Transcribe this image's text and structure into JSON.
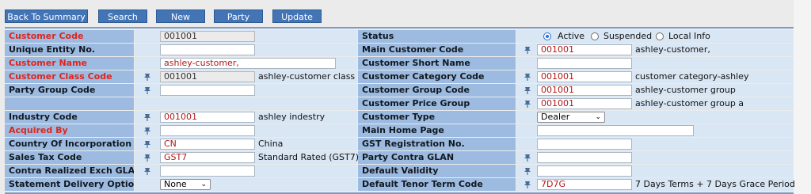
{
  "toolbar": {
    "back_label": "Back To Summary",
    "search_label": "Search",
    "new_label": "New",
    "party_label": "Party",
    "update_label": "Update"
  },
  "form": {
    "customer_code": {
      "label": "Customer Code",
      "value": "001001"
    },
    "unique_entity_no": {
      "label": "Unique Entity No.",
      "value": ""
    },
    "customer_name": {
      "label": "Customer Name",
      "value": "ashley-customer,"
    },
    "customer_class_code": {
      "label": "Customer Class Code",
      "value": "001001",
      "desc": "ashley-customer class"
    },
    "party_group_code": {
      "label": "Party Group Code",
      "value": ""
    },
    "industry_code": {
      "label": "Industry Code",
      "value": "001001",
      "desc": "ashley indestry"
    },
    "acquired_by": {
      "label": "Acquired By",
      "value": ""
    },
    "country_of_incorporation": {
      "label": "Country Of Incorporation",
      "value": "CN",
      "desc": "China"
    },
    "sales_tax_code": {
      "label": "Sales Tax Code",
      "value": "GST7",
      "desc": "Standard Rated (GST7)"
    },
    "contra_realized_exch_glan": {
      "label": "Contra Realized Exch GLAN",
      "value": ""
    },
    "statement_delivery_option": {
      "label": "Statement Delivery Option",
      "value": "None"
    },
    "status": {
      "label": "Status",
      "options": [
        "Active",
        "Suspended",
        "Local Info"
      ],
      "selected": "Active"
    },
    "main_customer_code": {
      "label": "Main Customer Code",
      "value": "001001",
      "desc": "ashley-customer,"
    },
    "customer_short_name": {
      "label": "Customer Short Name",
      "value": ""
    },
    "customer_category_code": {
      "label": "Customer Category Code",
      "value": "001001",
      "desc": "customer category-ashley"
    },
    "customer_group_code": {
      "label": "Customer Group Code",
      "value": "001001",
      "desc": "ashley-customer group"
    },
    "customer_price_group": {
      "label": "Customer Price Group",
      "value": "001001",
      "desc": "ashley-customer group a"
    },
    "customer_type": {
      "label": "Customer Type",
      "value": "Dealer"
    },
    "main_home_page": {
      "label": "Main Home Page",
      "value": ""
    },
    "gst_registration_no": {
      "label": "GST Registration No.",
      "value": ""
    },
    "party_contra_glan": {
      "label": "Party Contra GLAN",
      "value": ""
    },
    "default_validity": {
      "label": "Default Validity",
      "value": ""
    },
    "default_tenor_term_code": {
      "label": "Default Tenor Term Code",
      "value": "7D7G",
      "desc": "7 Days Terms + 7 Days Grace Period"
    }
  },
  "colors": {
    "button_bg": "#4375b6",
    "label_bg": "#9dbbe0",
    "cell_bg": "#d9e6f4",
    "required_label": "#e0241c",
    "value_text": "#b01818"
  },
  "icons": {
    "lookup": "lookup-pin-icon"
  }
}
